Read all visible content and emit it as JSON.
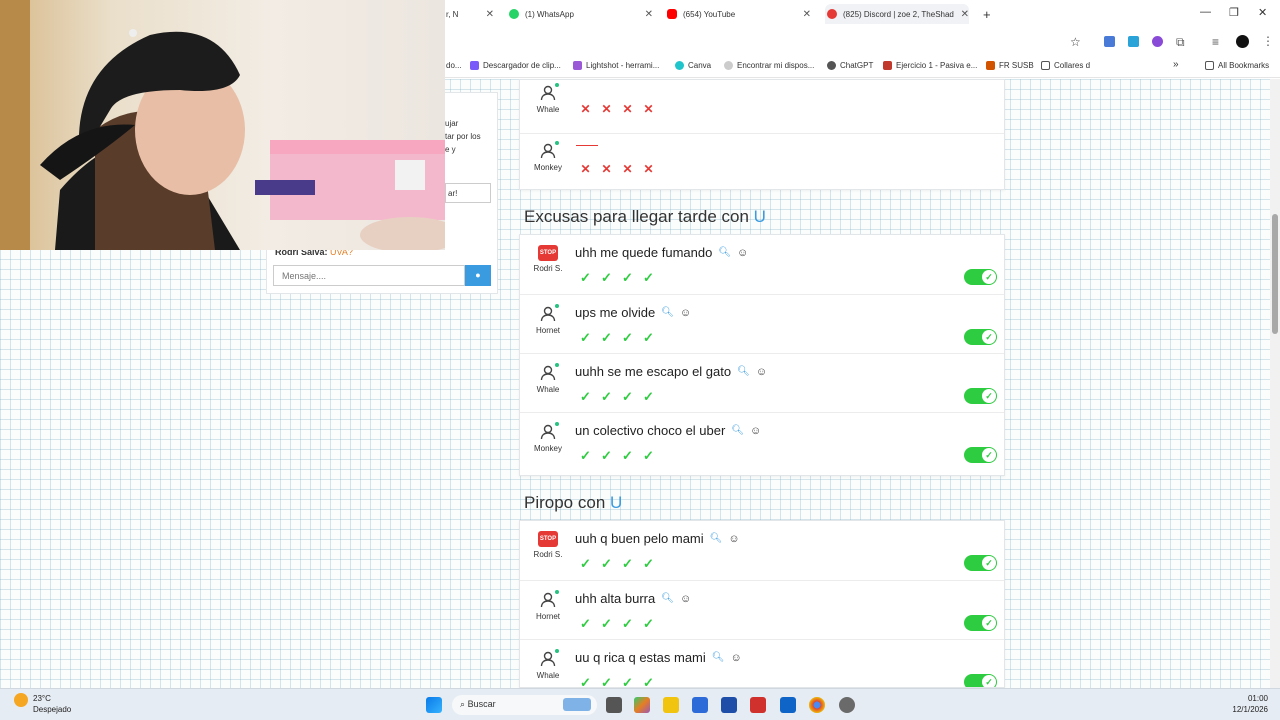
{
  "browser": {
    "tabs": [
      {
        "title": "r, N"
      },
      {
        "title": "(1) WhatsApp"
      },
      {
        "title": "(654) YouTube"
      },
      {
        "title": "(825) Discord | zoe 2, TheShad"
      }
    ],
    "new_tab": "+",
    "bookmarks": [
      "do...",
      "Descargador de clip...",
      "Lightshot - herrami...",
      "Canva",
      "Encontrar mi dispos...",
      "ChatGPT",
      "Ejercicio 1 - Pasiva e...",
      "FR SUSB",
      "Collares d",
      "»",
      "All Bookmarks"
    ]
  },
  "chat": {
    "snippet_lines": [
      "ujar",
      "tar por los",
      "e y"
    ],
    "button_fragment": "ar!",
    "last_message_user": "Rodri Salva:",
    "last_message_text": "UVA?",
    "input_placeholder": "Mensaje...."
  },
  "top_card": {
    "rows": [
      {
        "player": "Whale",
        "answer": "",
        "votes": [
          "x",
          "x",
          "x",
          "x"
        ]
      },
      {
        "player": "Monkey",
        "answer": "",
        "votes": [
          "x",
          "x",
          "x",
          "x"
        ]
      }
    ]
  },
  "sections": [
    {
      "title": "Excusas para llegar tarde con",
      "letter": "U",
      "rows": [
        {
          "player": "Rodri S.",
          "stop": true,
          "answer": "uhh me quede fumando"
        },
        {
          "player": "Hornet",
          "stop": false,
          "answer": "ups me olvide"
        },
        {
          "player": "Whale",
          "stop": false,
          "answer": "uuhh se me escapo el gato"
        },
        {
          "player": "Monkey",
          "stop": false,
          "answer": "un colectivo choco el uber"
        }
      ]
    },
    {
      "title": "Piropo con",
      "letter": "U",
      "rows": [
        {
          "player": "Rodri S.",
          "stop": true,
          "answer": "uuh q buen pelo mami"
        },
        {
          "player": "Hornet",
          "stop": false,
          "answer": "uhh alta burra"
        },
        {
          "player": "Whale",
          "stop": false,
          "answer": "uu q rica q estas mami"
        }
      ]
    }
  ],
  "stop_badge": "STOP",
  "taskbar": {
    "weather_temp": "23°C",
    "weather_desc": "Despejado",
    "search_label": "Buscar",
    "time": "01:00",
    "date": "12/1/2026"
  }
}
